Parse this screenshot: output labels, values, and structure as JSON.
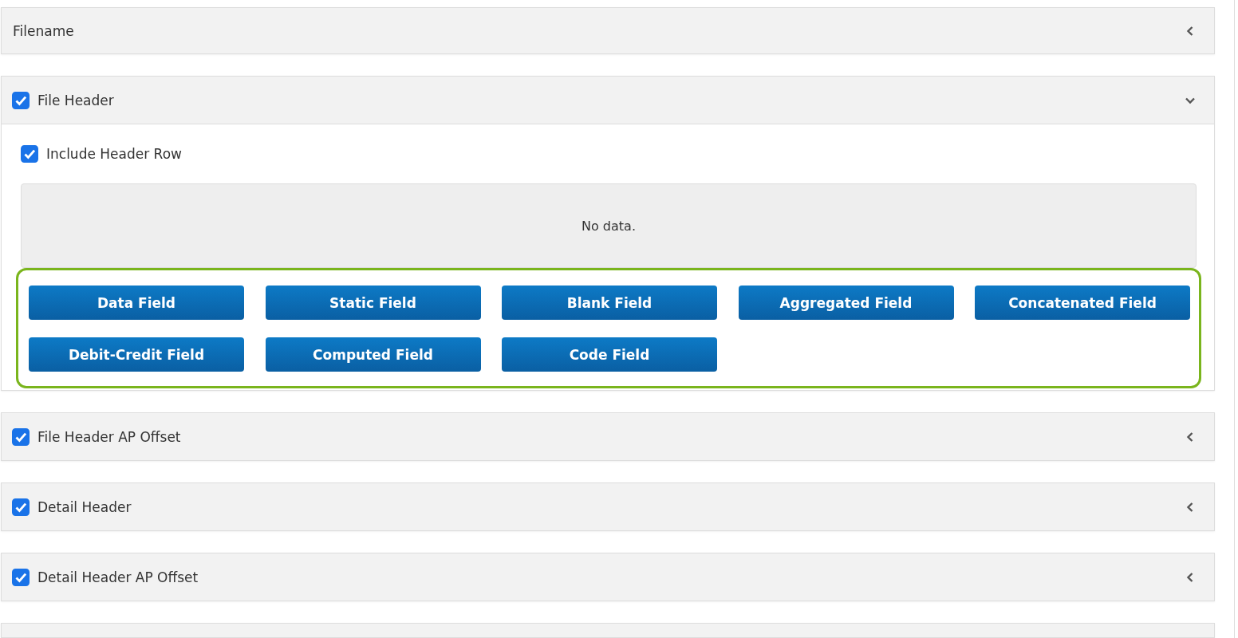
{
  "sections": [
    {
      "title": "Filename",
      "expanded": false
    },
    {
      "title": "File Header",
      "checked": true,
      "expanded": true,
      "body": {
        "include_header_row": {
          "label": "Include Header Row",
          "checked": true
        },
        "table": {
          "empty_message": "No data."
        },
        "field_buttons": [
          "Data Field",
          "Static Field",
          "Blank Field",
          "Aggregated Field",
          "Concatenated Field",
          "Debit-Credit Field",
          "Computed Field",
          "Code Field"
        ]
      }
    },
    {
      "title": "File Header AP Offset",
      "checked": true,
      "expanded": false
    },
    {
      "title": "Detail Header",
      "checked": true,
      "expanded": false
    },
    {
      "title": "Detail Header AP Offset",
      "checked": true,
      "expanded": false
    }
  ],
  "more_below": true
}
